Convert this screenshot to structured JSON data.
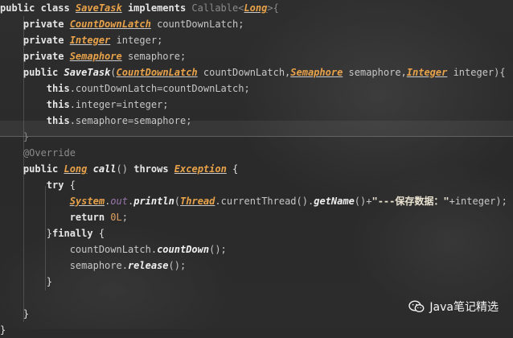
{
  "editor": {
    "lines": [
      [
        {
          "t": "public class ",
          "c": "kw"
        },
        {
          "t": "SaveTask",
          "c": "ty"
        },
        {
          "t": " implements ",
          "c": "kw"
        },
        {
          "t": "Callable<",
          "c": "ann"
        },
        {
          "t": "Long",
          "c": "ty"
        },
        {
          "t": ">{",
          "c": "ann"
        }
      ],
      [
        {
          "t": "    private ",
          "c": "kw"
        },
        {
          "t": "CountDownLatch",
          "c": "ty"
        },
        {
          "t": " countDownLatch;",
          "c": "dim"
        }
      ],
      [
        {
          "t": "    private ",
          "c": "kw"
        },
        {
          "t": "Integer",
          "c": "ty"
        },
        {
          "t": " integer;",
          "c": "dim"
        }
      ],
      [
        {
          "t": "    private ",
          "c": "kw"
        },
        {
          "t": "Semaphore",
          "c": "ty"
        },
        {
          "t": " semaphore;",
          "c": "dim"
        }
      ],
      [
        {
          "t": "    public ",
          "c": "kw"
        },
        {
          "t": "SaveTask",
          "c": "mth"
        },
        {
          "t": "(",
          "c": "dim"
        },
        {
          "t": "CountDownLatch",
          "c": "ty"
        },
        {
          "t": " countDownLatch,",
          "c": "dim"
        },
        {
          "t": "Semaphore",
          "c": "ty"
        },
        {
          "t": " semaphore,",
          "c": "dim"
        },
        {
          "t": "Integer",
          "c": "ty"
        },
        {
          "t": " integer){",
          "c": "dim"
        }
      ],
      [
        {
          "t": "        this",
          "c": "kw"
        },
        {
          "t": ".countDownLatch=countDownLatch;",
          "c": "dim"
        }
      ],
      [
        {
          "t": "        this",
          "c": "kw"
        },
        {
          "t": ".integer=integer;",
          "c": "dim"
        }
      ],
      [
        {
          "t": "        this",
          "c": "kw"
        },
        {
          "t": ".semaphore=semaphore;",
          "c": "dim"
        }
      ],
      [
        {
          "t": "    }",
          "c": "ann"
        }
      ],
      [
        {
          "t": "    @Override",
          "c": "ann"
        }
      ],
      [
        {
          "t": "    public ",
          "c": "kw"
        },
        {
          "t": "Long",
          "c": "ty"
        },
        {
          "t": " ",
          "c": "dim"
        },
        {
          "t": "call",
          "c": "mth"
        },
        {
          "t": "() ",
          "c": "dim"
        },
        {
          "t": "throws ",
          "c": "kw"
        },
        {
          "t": "Exception",
          "c": "ty"
        },
        {
          "t": " {",
          "c": "brace"
        }
      ],
      [
        {
          "t": "        try ",
          "c": "kw"
        },
        {
          "t": "{",
          "c": "brace"
        }
      ],
      [
        {
          "t": "            ",
          "c": "dim"
        },
        {
          "t": "System",
          "c": "ty"
        },
        {
          "t": ".",
          "c": "dim"
        },
        {
          "t": "out",
          "c": "fld"
        },
        {
          "t": ".",
          "c": "dim"
        },
        {
          "t": "println",
          "c": "mth"
        },
        {
          "t": "(",
          "c": "dim"
        },
        {
          "t": "Thread",
          "c": "ty"
        },
        {
          "t": ".currentThread().",
          "c": "dim"
        },
        {
          "t": "getName",
          "c": "mth"
        },
        {
          "t": "()+",
          "c": "dim"
        },
        {
          "t": "\"---保存数据：\"",
          "c": "str"
        },
        {
          "t": "+integer);",
          "c": "dim"
        }
      ],
      [
        {
          "t": "            return ",
          "c": "kw"
        },
        {
          "t": "0L",
          "c": "num"
        },
        {
          "t": ";",
          "c": "dim"
        }
      ],
      [
        {
          "t": "        }",
          "c": "brace"
        },
        {
          "t": "finally ",
          "c": "kw"
        },
        {
          "t": "{",
          "c": "brace"
        }
      ],
      [
        {
          "t": "            countDownLatch.",
          "c": "dim"
        },
        {
          "t": "countDown",
          "c": "mth"
        },
        {
          "t": "();",
          "c": "dim"
        }
      ],
      [
        {
          "t": "            semaphore.",
          "c": "dim"
        },
        {
          "t": "release",
          "c": "mth"
        },
        {
          "t": "();",
          "c": "dim"
        }
      ],
      [
        {
          "t": "        }",
          "c": "brace"
        }
      ],
      [
        {
          "t": "",
          "c": "dim"
        }
      ],
      [
        {
          "t": "    }",
          "c": "brace"
        }
      ],
      [
        {
          "t": "}",
          "c": "brace"
        }
      ]
    ]
  },
  "watermark": {
    "icon": "wechat-icon",
    "text": "Java笔记精选"
  }
}
